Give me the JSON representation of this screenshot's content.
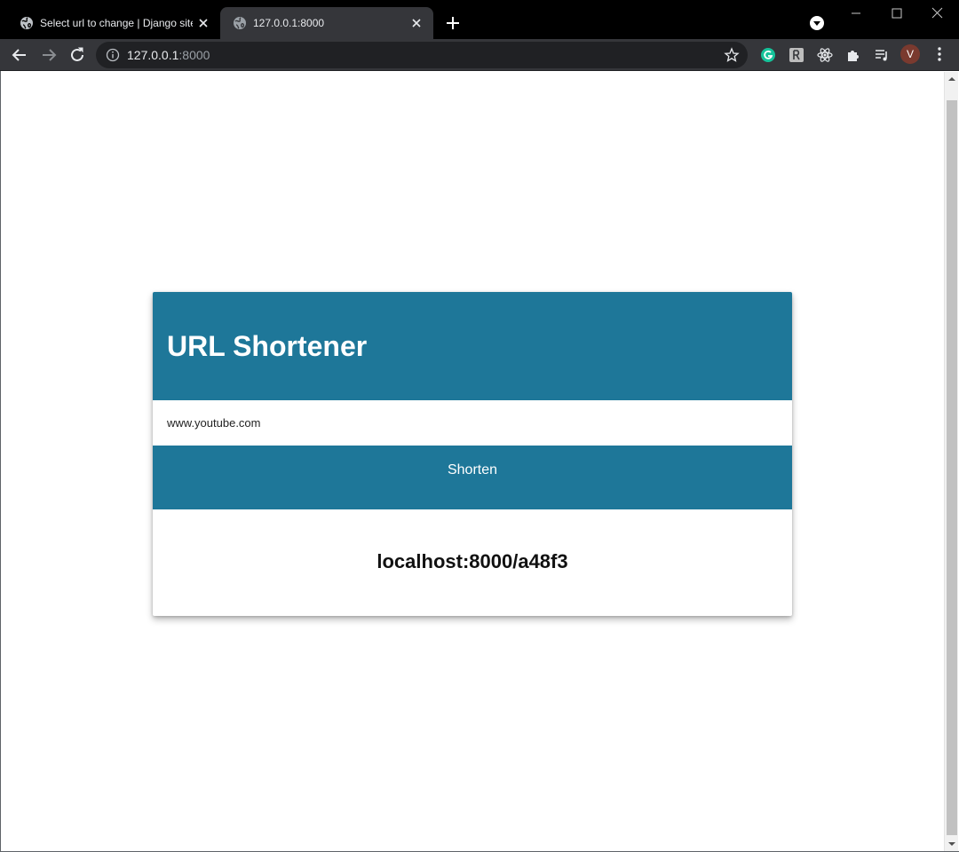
{
  "browser": {
    "tabs": [
      {
        "title": "Select url to change | Django site",
        "active": false,
        "icon": "globe-icon"
      },
      {
        "title": "127.0.0.1:8000",
        "active": true,
        "icon": "globe-icon"
      }
    ],
    "address": {
      "host": "127.0.0.1",
      "port": ":8000"
    },
    "profile_initial": "V",
    "extensions": [
      "grammarly-icon",
      "extension-r-icon",
      "react-devtools-icon",
      "puzzle-icon",
      "media-playlist-icon"
    ]
  },
  "app": {
    "title": "URL Shortener",
    "input_value": "www.youtube.com",
    "button_label": "Shorten",
    "result": "localhost:8000/a48f3"
  },
  "colors": {
    "accent": "#1e7799",
    "browser_bar": "#35363a",
    "tab_strip": "#000000"
  }
}
